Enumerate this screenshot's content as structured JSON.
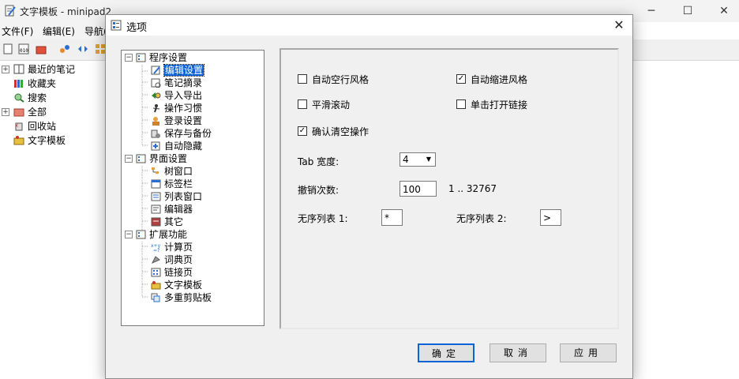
{
  "main_window": {
    "title": "文字模板 - minipad2",
    "menu": [
      "文件(F)",
      "编辑(E)",
      "导航("
    ],
    "tree": [
      "最近的笔记",
      "收藏夹",
      "搜索",
      "全部",
      "回收站",
      "文字模板"
    ]
  },
  "dialog": {
    "title": "选项",
    "tree": {
      "group1": {
        "label": "程序设置",
        "children": [
          "编辑设置",
          "笔记摘录",
          "导入导出",
          "操作习惯",
          "登录设置",
          "保存与备份",
          "自动隐藏"
        ]
      },
      "group2": {
        "label": "界面设置",
        "children": [
          "树窗口",
          "标签栏",
          "列表窗口",
          "编辑器",
          "其它"
        ]
      },
      "group3": {
        "label": "扩展功能",
        "children": [
          "计算页",
          "词典页",
          "链接页",
          "文字模板",
          "多重剪贴板"
        ]
      }
    },
    "settings": {
      "auto_blank_line": {
        "label": "自动空行风格",
        "checked": false
      },
      "auto_indent": {
        "label": "自动缩进风格",
        "checked": true
      },
      "smooth_scroll": {
        "label": "平滑滚动",
        "checked": false
      },
      "single_click_link": {
        "label": "单击打开链接",
        "checked": false
      },
      "confirm_clear": {
        "label": "确认清空操作",
        "checked": true
      },
      "tab_width": {
        "label": "Tab 宽度:",
        "value": "4"
      },
      "undo_count": {
        "label": "撤销次数:",
        "value": "100",
        "range": "1 .. 32767"
      },
      "bullet1": {
        "label": "无序列表 1:",
        "value": "*"
      },
      "bullet2": {
        "label": "无序列表 2:",
        "value": ">"
      }
    },
    "buttons": {
      "ok": "确定",
      "cancel": "取消",
      "apply": "应用"
    }
  },
  "icons": {
    "check_mark": "✓",
    "close": "✕",
    "dropdown": "▼",
    "collapse": "−",
    "expand": "+"
  }
}
